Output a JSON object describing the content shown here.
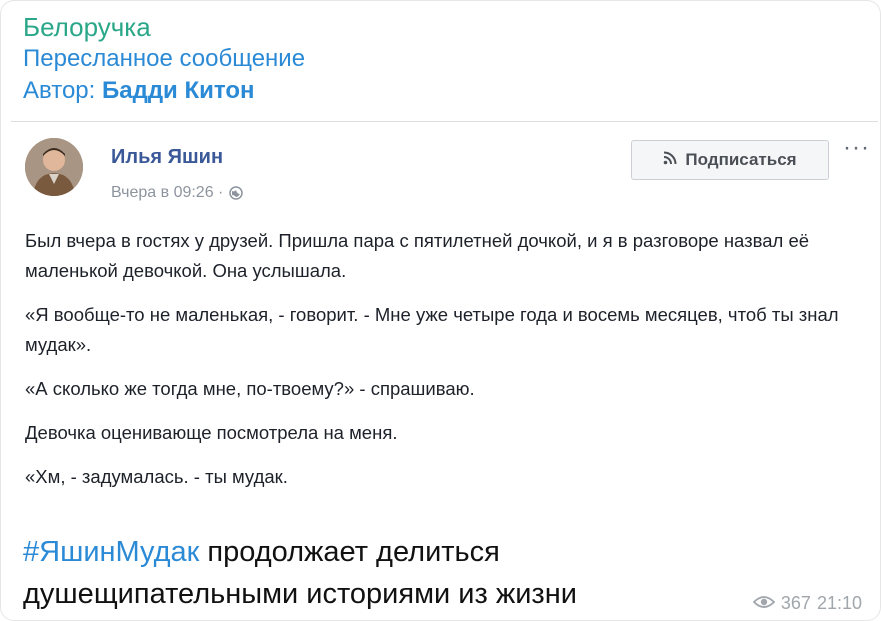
{
  "header": {
    "channel_name": "Белоручка",
    "forward_label": "Пересланное сообщение",
    "forward_author_prefix": "Автор: ",
    "forward_author_name": "Бадди Китон"
  },
  "post": {
    "author": "Илья Яшин",
    "timestamp": "Вчера в 09:26 ·",
    "subscribe_label": "Подписаться",
    "more_label": "···",
    "paragraphs": [
      "Был вчера в гостях у друзей. Пришла пара с пятилетней дочкой, и я в разговоре назвал её маленькой девочкой. Она услышала.",
      "«Я вообще-то не маленькая, - говорит. - Мне уже четыре года и восемь месяцев, чтоб ты знал мудак».",
      "«А сколько же тогда мне, по-твоему?» - спрашиваю.",
      "Девочка оценивающе посмотрела на меня.",
      "«Хм, - задумалась. - ты мудак."
    ]
  },
  "caption": {
    "hashtag": "#ЯшинМудак",
    "text": " продолжает делиться душещипательными историями из жизни"
  },
  "footer": {
    "views": "367",
    "time": "21:10"
  },
  "icons": {
    "eye": "eye-icon",
    "globe": "globe-icon",
    "rss": "rss-icon"
  },
  "colors": {
    "channel": "#2aa788",
    "link": "#2b8ad6",
    "fb_author": "#3b5998"
  }
}
